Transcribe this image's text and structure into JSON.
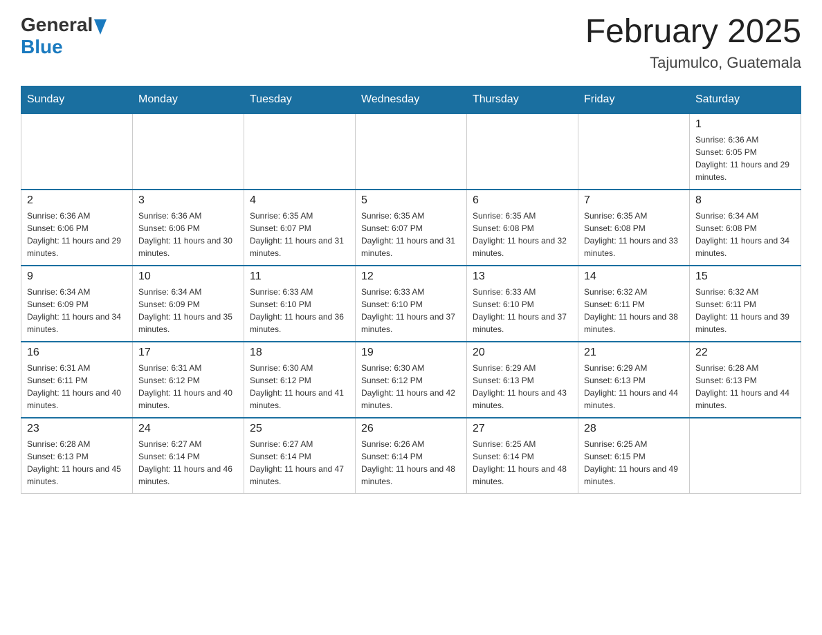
{
  "header": {
    "logo_general": "General",
    "logo_blue": "Blue",
    "month_year": "February 2025",
    "location": "Tajumulco, Guatemala"
  },
  "weekdays": [
    "Sunday",
    "Monday",
    "Tuesday",
    "Wednesday",
    "Thursday",
    "Friday",
    "Saturday"
  ],
  "weeks": [
    [
      {
        "day": "",
        "sunrise": "",
        "sunset": "",
        "daylight": ""
      },
      {
        "day": "",
        "sunrise": "",
        "sunset": "",
        "daylight": ""
      },
      {
        "day": "",
        "sunrise": "",
        "sunset": "",
        "daylight": ""
      },
      {
        "day": "",
        "sunrise": "",
        "sunset": "",
        "daylight": ""
      },
      {
        "day": "",
        "sunrise": "",
        "sunset": "",
        "daylight": ""
      },
      {
        "day": "",
        "sunrise": "",
        "sunset": "",
        "daylight": ""
      },
      {
        "day": "1",
        "sunrise": "Sunrise: 6:36 AM",
        "sunset": "Sunset: 6:05 PM",
        "daylight": "Daylight: 11 hours and 29 minutes."
      }
    ],
    [
      {
        "day": "2",
        "sunrise": "Sunrise: 6:36 AM",
        "sunset": "Sunset: 6:06 PM",
        "daylight": "Daylight: 11 hours and 29 minutes."
      },
      {
        "day": "3",
        "sunrise": "Sunrise: 6:36 AM",
        "sunset": "Sunset: 6:06 PM",
        "daylight": "Daylight: 11 hours and 30 minutes."
      },
      {
        "day": "4",
        "sunrise": "Sunrise: 6:35 AM",
        "sunset": "Sunset: 6:07 PM",
        "daylight": "Daylight: 11 hours and 31 minutes."
      },
      {
        "day": "5",
        "sunrise": "Sunrise: 6:35 AM",
        "sunset": "Sunset: 6:07 PM",
        "daylight": "Daylight: 11 hours and 31 minutes."
      },
      {
        "day": "6",
        "sunrise": "Sunrise: 6:35 AM",
        "sunset": "Sunset: 6:08 PM",
        "daylight": "Daylight: 11 hours and 32 minutes."
      },
      {
        "day": "7",
        "sunrise": "Sunrise: 6:35 AM",
        "sunset": "Sunset: 6:08 PM",
        "daylight": "Daylight: 11 hours and 33 minutes."
      },
      {
        "day": "8",
        "sunrise": "Sunrise: 6:34 AM",
        "sunset": "Sunset: 6:08 PM",
        "daylight": "Daylight: 11 hours and 34 minutes."
      }
    ],
    [
      {
        "day": "9",
        "sunrise": "Sunrise: 6:34 AM",
        "sunset": "Sunset: 6:09 PM",
        "daylight": "Daylight: 11 hours and 34 minutes."
      },
      {
        "day": "10",
        "sunrise": "Sunrise: 6:34 AM",
        "sunset": "Sunset: 6:09 PM",
        "daylight": "Daylight: 11 hours and 35 minutes."
      },
      {
        "day": "11",
        "sunrise": "Sunrise: 6:33 AM",
        "sunset": "Sunset: 6:10 PM",
        "daylight": "Daylight: 11 hours and 36 minutes."
      },
      {
        "day": "12",
        "sunrise": "Sunrise: 6:33 AM",
        "sunset": "Sunset: 6:10 PM",
        "daylight": "Daylight: 11 hours and 37 minutes."
      },
      {
        "day": "13",
        "sunrise": "Sunrise: 6:33 AM",
        "sunset": "Sunset: 6:10 PM",
        "daylight": "Daylight: 11 hours and 37 minutes."
      },
      {
        "day": "14",
        "sunrise": "Sunrise: 6:32 AM",
        "sunset": "Sunset: 6:11 PM",
        "daylight": "Daylight: 11 hours and 38 minutes."
      },
      {
        "day": "15",
        "sunrise": "Sunrise: 6:32 AM",
        "sunset": "Sunset: 6:11 PM",
        "daylight": "Daylight: 11 hours and 39 minutes."
      }
    ],
    [
      {
        "day": "16",
        "sunrise": "Sunrise: 6:31 AM",
        "sunset": "Sunset: 6:11 PM",
        "daylight": "Daylight: 11 hours and 40 minutes."
      },
      {
        "day": "17",
        "sunrise": "Sunrise: 6:31 AM",
        "sunset": "Sunset: 6:12 PM",
        "daylight": "Daylight: 11 hours and 40 minutes."
      },
      {
        "day": "18",
        "sunrise": "Sunrise: 6:30 AM",
        "sunset": "Sunset: 6:12 PM",
        "daylight": "Daylight: 11 hours and 41 minutes."
      },
      {
        "day": "19",
        "sunrise": "Sunrise: 6:30 AM",
        "sunset": "Sunset: 6:12 PM",
        "daylight": "Daylight: 11 hours and 42 minutes."
      },
      {
        "day": "20",
        "sunrise": "Sunrise: 6:29 AM",
        "sunset": "Sunset: 6:13 PM",
        "daylight": "Daylight: 11 hours and 43 minutes."
      },
      {
        "day": "21",
        "sunrise": "Sunrise: 6:29 AM",
        "sunset": "Sunset: 6:13 PM",
        "daylight": "Daylight: 11 hours and 44 minutes."
      },
      {
        "day": "22",
        "sunrise": "Sunrise: 6:28 AM",
        "sunset": "Sunset: 6:13 PM",
        "daylight": "Daylight: 11 hours and 44 minutes."
      }
    ],
    [
      {
        "day": "23",
        "sunrise": "Sunrise: 6:28 AM",
        "sunset": "Sunset: 6:13 PM",
        "daylight": "Daylight: 11 hours and 45 minutes."
      },
      {
        "day": "24",
        "sunrise": "Sunrise: 6:27 AM",
        "sunset": "Sunset: 6:14 PM",
        "daylight": "Daylight: 11 hours and 46 minutes."
      },
      {
        "day": "25",
        "sunrise": "Sunrise: 6:27 AM",
        "sunset": "Sunset: 6:14 PM",
        "daylight": "Daylight: 11 hours and 47 minutes."
      },
      {
        "day": "26",
        "sunrise": "Sunrise: 6:26 AM",
        "sunset": "Sunset: 6:14 PM",
        "daylight": "Daylight: 11 hours and 48 minutes."
      },
      {
        "day": "27",
        "sunrise": "Sunrise: 6:25 AM",
        "sunset": "Sunset: 6:14 PM",
        "daylight": "Daylight: 11 hours and 48 minutes."
      },
      {
        "day": "28",
        "sunrise": "Sunrise: 6:25 AM",
        "sunset": "Sunset: 6:15 PM",
        "daylight": "Daylight: 11 hours and 49 minutes."
      },
      {
        "day": "",
        "sunrise": "",
        "sunset": "",
        "daylight": ""
      }
    ]
  ]
}
